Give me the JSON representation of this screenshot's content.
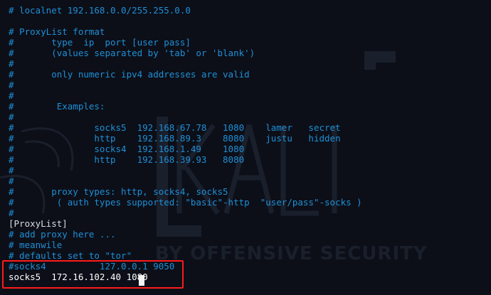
{
  "terminal": {
    "lines": [
      {
        "text": "# localnet 192.168.0.0/255.255.0.0",
        "kind": "comment"
      },
      {
        "text": "",
        "kind": "comment"
      },
      {
        "text": "# ProxyList format",
        "kind": "comment"
      },
      {
        "text": "#       type  ip  port [user pass]",
        "kind": "comment"
      },
      {
        "text": "#       (values separated by 'tab' or 'blank')",
        "kind": "comment"
      },
      {
        "text": "#",
        "kind": "comment"
      },
      {
        "text": "#       only numeric ipv4 addresses are valid",
        "kind": "comment"
      },
      {
        "text": "#",
        "kind": "comment"
      },
      {
        "text": "#",
        "kind": "comment"
      },
      {
        "text": "#        Examples:",
        "kind": "comment"
      },
      {
        "text": "#",
        "kind": "comment"
      },
      {
        "text": "#               socks5  192.168.67.78   1080    lamer   secret",
        "kind": "comment"
      },
      {
        "text": "#               http    192.168.89.3    8080    justu   hidden",
        "kind": "comment"
      },
      {
        "text": "#               socks4  192.168.1.49    1080",
        "kind": "comment"
      },
      {
        "text": "#               http    192.168.39.93   8080",
        "kind": "comment"
      },
      {
        "text": "#",
        "kind": "comment"
      },
      {
        "text": "#",
        "kind": "comment"
      },
      {
        "text": "#       proxy types: http, socks4, socks5",
        "kind": "comment"
      },
      {
        "text": "#        ( auth types supported: \"basic\"-http  \"user/pass\"-socks )",
        "kind": "comment"
      },
      {
        "text": "#",
        "kind": "comment"
      },
      {
        "text": "[ProxyList]",
        "kind": "header"
      },
      {
        "text": "# add proxy here ...",
        "kind": "comment"
      },
      {
        "text": "# meanwile",
        "kind": "comment"
      },
      {
        "text": "# defaults set to \"tor\"",
        "kind": "comment"
      },
      {
        "text": "#socks4          127.0.0.1 9050",
        "kind": "comment"
      },
      {
        "text": "socks5  172.16.102.40 1080",
        "kind": "plain"
      }
    ]
  },
  "watermark": {
    "brand": "KALI",
    "tagline": "BY OFFENSIVE SECURITY"
  },
  "colors": {
    "background": "#0c0f18",
    "comment": "#1f8fd6",
    "plain": "#ffffff",
    "highlight_border": "#ff1a1a"
  }
}
